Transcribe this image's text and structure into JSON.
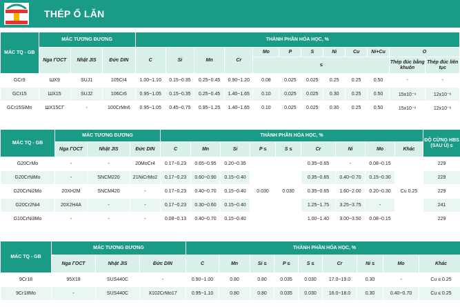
{
  "page": {
    "title": "THÉP Ổ LĂN",
    "logo_icon": "machinery-logo",
    "accent": "#1a9b85",
    "light": "#d9efe9"
  },
  "t1": {
    "grade_header": "MÁC TQ - GB",
    "equiv_header": "MÁC TƯƠNG ĐƯƠNG",
    "comp_header": "THÀNH PHẦN HÓA HỌC, %",
    "equiv_cols": [
      "Nga ГОСТ",
      "Nhật JIS",
      "Đức DIN"
    ],
    "main_cols": [
      "C",
      "Si",
      "Mn",
      "Cr"
    ],
    "max_cols": [
      "Mo",
      "P",
      "S",
      "Ni",
      "Cu",
      "Ni+Cu"
    ],
    "max_sym": "≤",
    "o_header": "O",
    "o_cols": [
      "Thép đúc bằng khuôn",
      "Thép đúc liên tục"
    ],
    "rows": [
      [
        "GCr9",
        "ШХ9",
        "SUJ1",
        "105Cr4",
        "1.00~1.10",
        "0.15~0.35",
        "0.25~0.45",
        "0.90~1.20",
        "0.08",
        "0.025",
        "0.025",
        "0.25",
        "0.25",
        "0.50",
        "-",
        "-"
      ],
      [
        "GCr15",
        "ШХ15",
        "SUJ2",
        "106Cr6",
        "0.95~1.05",
        "0.15~0.35",
        "0.25~0.45",
        "1.40~1.65",
        "0.10",
        "0.025",
        "0.025",
        "0.30",
        "0.25",
        "0.50",
        "15x10⁻⁶",
        "12x10⁻⁶"
      ],
      [
        "GCr15SiMn",
        "ШХ15СГ",
        "-",
        "100CrMn6",
        "0.95~1.05",
        "0.45~0.75",
        "0.95~1.25",
        "1.40~1.65",
        "0.10",
        "0.025",
        "0.025",
        "0.30",
        "0.25",
        "0.50",
        "15x10⁻⁶",
        "12x10⁻⁶"
      ]
    ]
  },
  "t2": {
    "grade_header": "MÁC TQ - GB",
    "equiv_header": "MÁC TƯƠNG ĐƯƠNG",
    "comp_header": "THÀNH PHẦN HÓA HỌC, %",
    "hb_header": "ĐỘ CỨNG HBS (SAU Ủ) ≤",
    "equiv_cols": [
      "Nga ГОСТ",
      "Nhật JIS",
      "Đức DIN"
    ],
    "comp_cols": [
      "C",
      "Mn",
      "Si",
      "P ≤",
      "S ≤",
      "Cr",
      "Ni",
      "Mo",
      "Khác"
    ],
    "shared_P": "0.030",
    "shared_S": "0.030",
    "shared_other": "Cu 0.25",
    "rows": [
      [
        "G20CrMo",
        "-",
        "-",
        "20MoCr4",
        "0.17~0.23",
        "0.65~0.95",
        "0.20~0.35",
        "0.35~0.65",
        "-",
        "0.08~0.15",
        "229"
      ],
      [
        "G20CrNiMo",
        "-",
        "SNCM220",
        "21NiCrMo2",
        "0.17~0.23",
        "0.60~0.90",
        "0.15~0.40",
        "0.35~0.65",
        "0.40~0.70",
        "0.15~0.30",
        "229"
      ],
      [
        "G20CrNi2Mo",
        "20ХН2М",
        "SNCM420",
        "-",
        "0.17~0.23",
        "0.40~0.70",
        "0.15~0.40",
        "0.35~0.65",
        "1.60~2.00",
        "0.20~0.30",
        "229"
      ],
      [
        "G20Cr2Ni4",
        "20Х2Н4А",
        "-",
        "-",
        "0.17~0.23",
        "0.30~0.60",
        "0.15~0.40",
        "1.25~1.75",
        "3.25~3.75",
        "-",
        "241"
      ],
      [
        "G10CrNi3Mo",
        "-",
        "-",
        "-",
        "0.08~0.13",
        "0.40~0.70",
        "0.15~0.40",
        "1.00~1.40",
        "3.00~3.50",
        "0.08~0.15",
        "229"
      ]
    ]
  },
  "t3": {
    "grade_header": "MÁC TQ - GB",
    "equiv_header": "MÁC TƯƠNG ĐƯƠNG",
    "comp_header": "THÀNH PHẦN HÓA HỌC, %",
    "equiv_cols": [
      "Nga ГОСТ",
      "Nhật JIS",
      "Đức DIN"
    ],
    "comp_cols": [
      "C",
      "Mn",
      "Si ≤",
      "P ≤",
      "S ≤",
      "Cr",
      "Ni ≤",
      "Mo",
      "Khác"
    ],
    "rows": [
      [
        "9Cr18",
        "95Х18",
        "SUS440C",
        "-",
        "0.90~1.00",
        "0.80",
        "0.80",
        "0.035",
        "0.030",
        "17.0~19.0",
        "0.30",
        "-",
        "Cu ≤ 0.25"
      ],
      [
        "9Cr18Mo",
        "-",
        "SUS440C",
        "X102CrMo17",
        "0.95~1.10",
        "0.80",
        "0.80",
        "0.035",
        "0.030",
        "16.0~18.0",
        "0.30",
        "0.40~0.70",
        "Cu ≤ 0.25"
      ]
    ]
  }
}
